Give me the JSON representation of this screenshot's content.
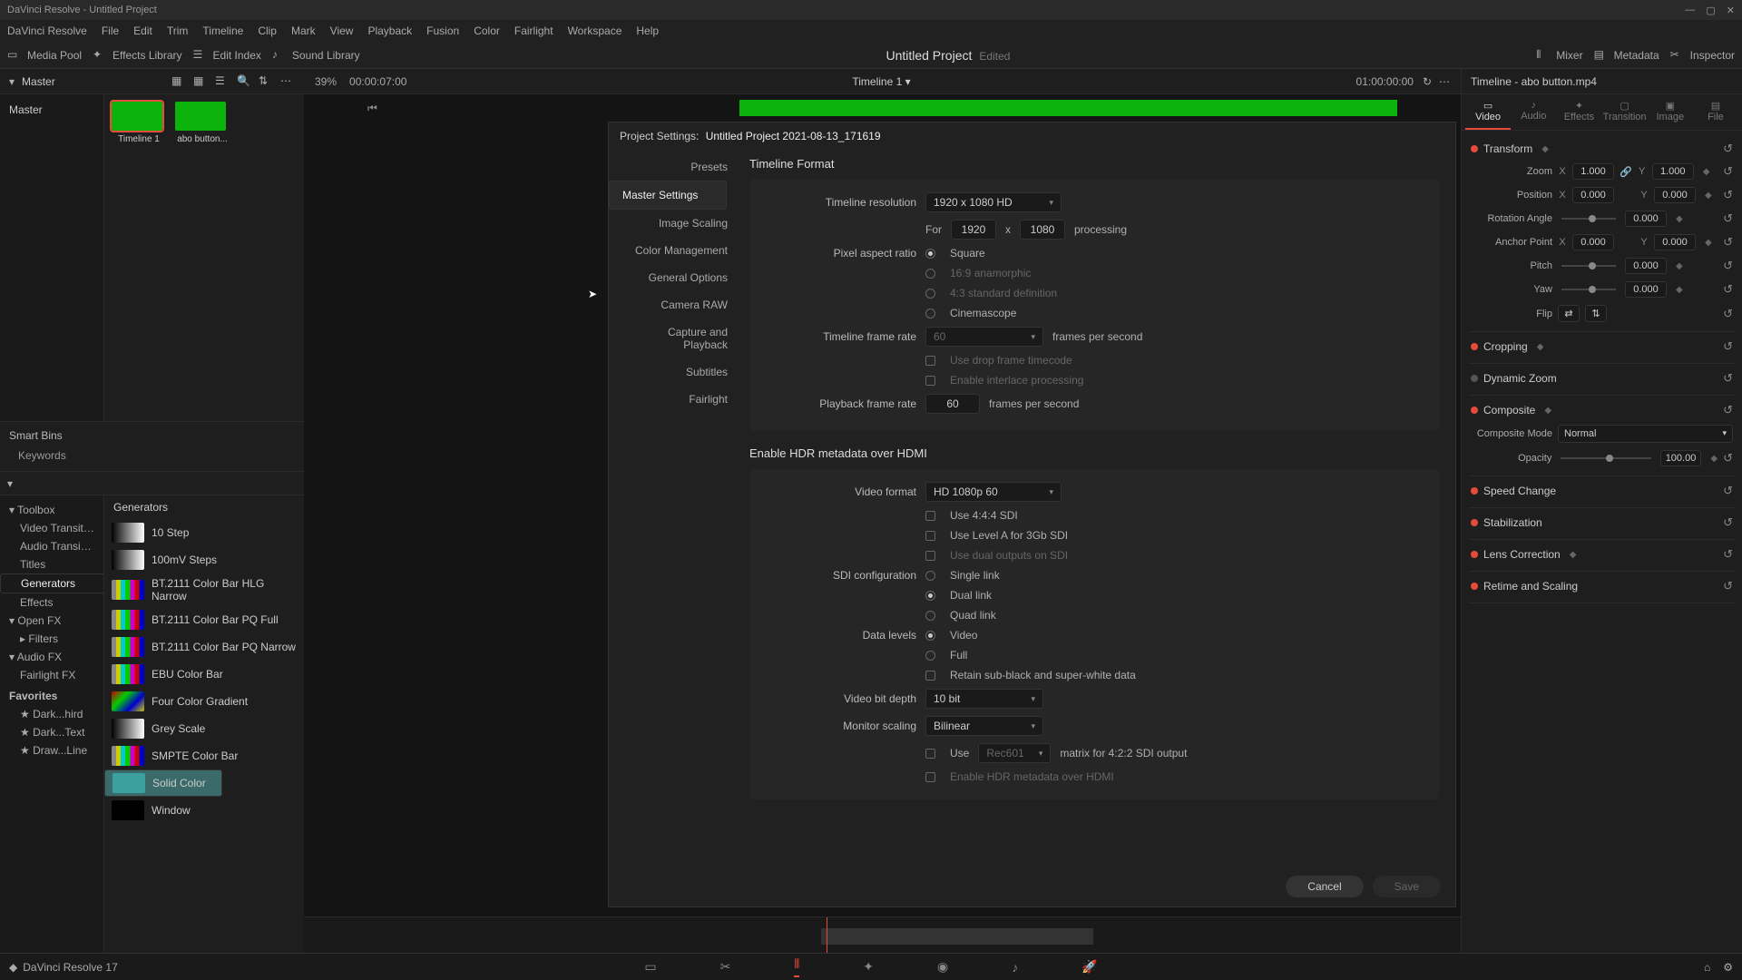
{
  "titlebar": "DaVinci Resolve - Untitled Project",
  "menus": [
    "DaVinci Resolve",
    "File",
    "Edit",
    "Trim",
    "Timeline",
    "Clip",
    "Mark",
    "View",
    "Playback",
    "Fusion",
    "Color",
    "Fairlight",
    "Workspace",
    "Help"
  ],
  "toolbar": {
    "media_pool": "Media Pool",
    "effects_library": "Effects Library",
    "edit_index": "Edit Index",
    "sound_library": "Sound Library",
    "mixer": "Mixer",
    "metadata": "Metadata",
    "inspector": "Inspector"
  },
  "project": {
    "title": "Untitled Project",
    "status": "Edited"
  },
  "media": {
    "master": "Master",
    "clips": [
      {
        "name": "Timeline 1",
        "selected": true
      },
      {
        "name": "abo button...",
        "selected": false
      }
    ],
    "smart_bins": "Smart Bins",
    "keywords": "Keywords"
  },
  "viewer": {
    "zoom": "39%",
    "tc": "00:00:07:00",
    "name": "Timeline 1",
    "end_tc": "01:00:00:00"
  },
  "fx": {
    "tree": {
      "toolbox": "Toolbox",
      "video_trans": "Video Transitions",
      "audio_trans": "Audio Transitions",
      "titles": "Titles",
      "generators": "Generators",
      "effects": "Effects",
      "openfx": "Open FX",
      "filters": "Filters",
      "audiofx": "Audio FX",
      "fairlightfx": "Fairlight FX",
      "favorites": "Favorites",
      "fav1": "Dark...hird",
      "fav2": "Dark...Text",
      "fav3": "Draw...Line"
    },
    "list_hdr": "Generators",
    "items": [
      "10 Step",
      "100mV Steps",
      "BT.2111 Color Bar HLG Narrow",
      "BT.2111 Color Bar PQ Full",
      "BT.2111 Color Bar PQ Narrow",
      "EBU Color Bar",
      "Four Color Gradient",
      "Grey Scale",
      "SMPTE Color Bar",
      "Solid Color",
      "Window"
    ]
  },
  "settings": {
    "hdr_prefix": "Project Settings:",
    "project_name": "Untitled Project 2021-08-13_171619",
    "nav": [
      "Presets",
      "Master Settings",
      "Image Scaling",
      "Color Management",
      "General Options",
      "Camera RAW",
      "Capture and Playback",
      "Subtitles",
      "Fairlight"
    ],
    "timeline_format": {
      "hdr": "Timeline Format",
      "res_label": "Timeline resolution",
      "res_value": "1920 x 1080 HD",
      "for": "For",
      "w": "1920",
      "x": "x",
      "h": "1080",
      "processing": "processing",
      "par_label": "Pixel aspect ratio",
      "par_opts": [
        "Square",
        "16:9 anamorphic",
        "4:3 standard definition",
        "Cinemascope"
      ],
      "tfr_label": "Timeline frame rate",
      "tfr_value": "60",
      "fps": "frames per second",
      "dropframe": "Use drop frame timecode",
      "interlace": "Enable interlace processing",
      "pfr_label": "Playback frame rate",
      "pfr_value": "60"
    },
    "video_monitoring": {
      "hdr": "Enable HDR metadata over HDMI",
      "vf_label": "Video format",
      "vf_value": "HD 1080p 60",
      "use444": "Use 4:4:4 SDI",
      "levela": "Use Level A for 3Gb SDI",
      "dual_out": "Use dual outputs on SDI",
      "sdi_label": "SDI configuration",
      "sdi_opts": [
        "Single link",
        "Dual link",
        "Quad link"
      ],
      "dl_label": "Data levels",
      "dl_opts": [
        "Video",
        "Full"
      ],
      "retain": "Retain sub-black and super-white data",
      "bitdepth_label": "Video bit depth",
      "bitdepth_value": "10 bit",
      "monscale_label": "Monitor scaling",
      "monscale_value": "Bilinear",
      "use": "Use",
      "rec": "Rec601",
      "matrix_suffix": "matrix for 4:2:2 SDI output"
    },
    "cancel": "Cancel",
    "save": "Save"
  },
  "inspector": {
    "hdr": "Timeline - abo button.mp4",
    "tabs": [
      "Video",
      "Audio",
      "Effects",
      "Transition",
      "Image",
      "File"
    ],
    "transform": {
      "hdr": "Transform",
      "zoom": "Zoom",
      "zx": "1.000",
      "zy": "1.000",
      "position": "Position",
      "px": "0.000",
      "py": "0.000",
      "rotation": "Rotation Angle",
      "rv": "0.000",
      "anchor": "Anchor Point",
      "ax": "0.000",
      "ay": "0.000",
      "pitch": "Pitch",
      "pv": "0.000",
      "yaw": "Yaw",
      "yv": "0.000",
      "flip": "Flip"
    },
    "cropping": "Cropping",
    "dynamic_zoom": "Dynamic Zoom",
    "composite": {
      "hdr": "Composite",
      "mode_label": "Composite Mode",
      "mode_value": "Normal",
      "opacity_label": "Opacity",
      "opacity_value": "100.00"
    },
    "speed": "Speed Change",
    "stabilization": "Stabilization",
    "lens": "Lens Correction",
    "retime": "Retime and Scaling"
  },
  "status": {
    "app": "DaVinci Resolve 17"
  }
}
